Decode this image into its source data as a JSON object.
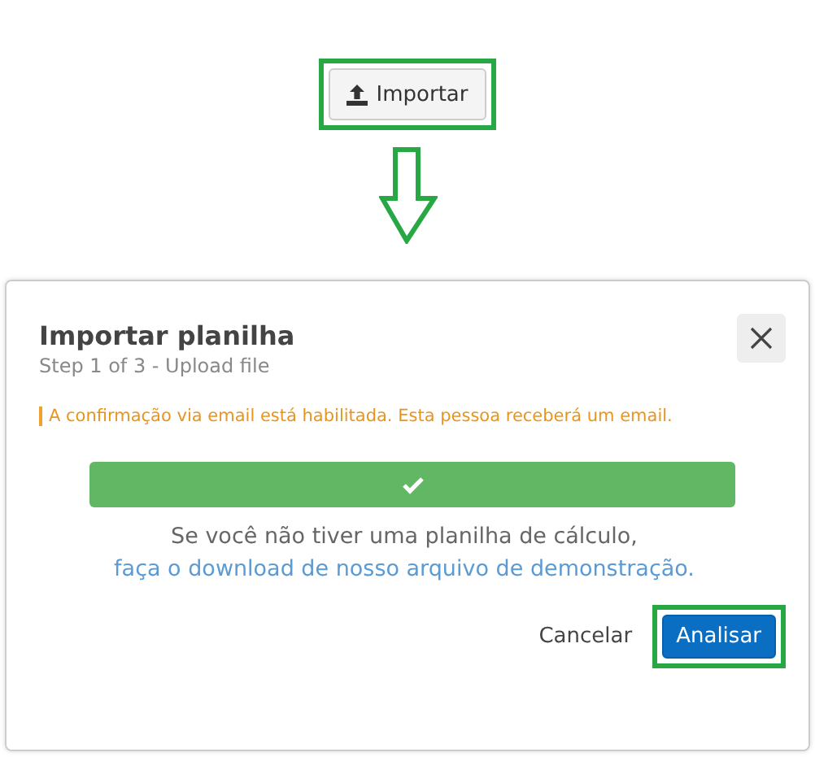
{
  "import_button": {
    "label": "Importar",
    "highlighted": true
  },
  "modal": {
    "title": "Importar planilha",
    "subtitle": "Step 1 of 3 - Upload file",
    "alert": "A confirmação via email está habilitada. Esta pessoa receberá um email.",
    "upload": {
      "level": 1,
      "done": true
    },
    "hint": {
      "text": "Se você não tiver uma planilha de cálculo,",
      "link": "faça o download de nosso arquivo de demonstração."
    },
    "buttons": [
      {
        "label": "Cancelar",
        "kind": "link",
        "highlighted": false
      },
      {
        "label": "Analisar",
        "kind": "primary",
        "highlighted": true
      }
    ]
  }
}
